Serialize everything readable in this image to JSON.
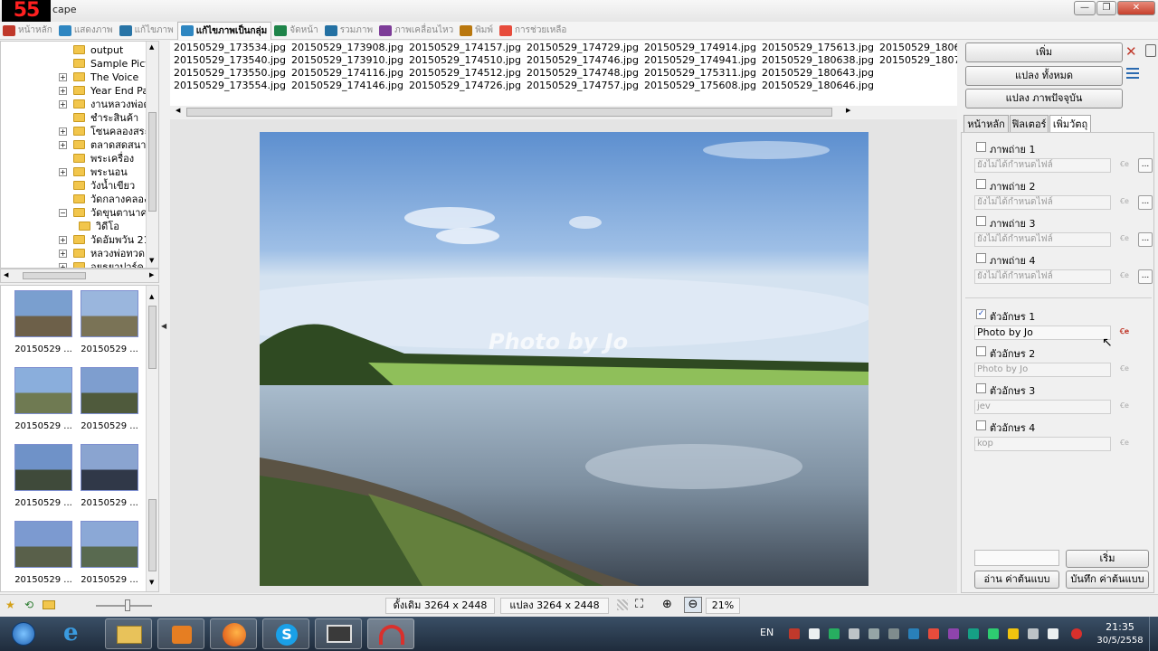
{
  "window": {
    "logo": "55",
    "title": "cape",
    "controls": [
      "—",
      "❐",
      "✕"
    ]
  },
  "menu": [
    {
      "label": "หน้าหลัก",
      "icon": "home-icon",
      "color": "#c0392b",
      "active": false
    },
    {
      "label": "แสดงภาพ",
      "icon": "view-icon",
      "color": "#2e86c1",
      "active": false
    },
    {
      "label": "แก้ไขภาพ",
      "icon": "edit-icon",
      "color": "#2874a6",
      "active": false
    },
    {
      "label": "แก้ไขภาพเป็นกลุ่ม",
      "icon": "batch-edit-icon",
      "color": "#2e86c1",
      "active": true
    },
    {
      "label": "จัดหน้า",
      "icon": "page-layout-icon",
      "color": "#1e8449",
      "active": false
    },
    {
      "label": "รวมภาพ",
      "icon": "combine-icon",
      "color": "#2471a3",
      "active": false
    },
    {
      "label": "ภาพเคลื่อนไหว",
      "icon": "animation-icon",
      "color": "#7d3c98",
      "active": false
    },
    {
      "label": "พิมพ์",
      "icon": "print-icon",
      "color": "#b9770e",
      "active": false
    },
    {
      "label": "การช่วยเหลือ",
      "icon": "help-icon",
      "color": "#e74c3c",
      "active": false
    }
  ],
  "tree": [
    {
      "label": "output",
      "exp": false
    },
    {
      "label": "Sample Pict",
      "exp": false
    },
    {
      "label": "The Voice",
      "exp": true
    },
    {
      "label": "Year End Pa",
      "exp": true
    },
    {
      "label": "งานหลวงพ่อดู",
      "exp": true
    },
    {
      "label": "ชำระสินค้า",
      "exp": false
    },
    {
      "label": "โซนคลองสระ",
      "exp": true
    },
    {
      "label": "ตลาดสดสนาม",
      "exp": true
    },
    {
      "label": "พระเครื่อง",
      "exp": false
    },
    {
      "label": "พระนอน",
      "exp": true
    },
    {
      "label": "วังน้ำเขียว",
      "exp": false
    },
    {
      "label": "วัดกลางคลอง",
      "exp": false
    },
    {
      "label": "วัดขุนตานาค",
      "exp": true
    },
    {
      "label": "วิดีโอ",
      "exp": false
    },
    {
      "label": "วัดอัมพวัน 21",
      "exp": true
    },
    {
      "label": "หลวงพ่อทวด",
      "exp": true
    },
    {
      "label": "อยุธยาปาร์ค",
      "exp": true
    }
  ],
  "thumbnails": [
    {
      "caption": "20150529 ...",
      "sky": "#7a9fcf",
      "ground": "#6d6049"
    },
    {
      "caption": "20150529 ...",
      "sky": "#9ab6dd",
      "ground": "#7a7356"
    },
    {
      "caption": "20150529 ...",
      "sky": "#8aaedc",
      "ground": "#6f7a52"
    },
    {
      "caption": "20150529 ...",
      "sky": "#7e9ecf",
      "ground": "#4f5a3c"
    },
    {
      "caption": "20150529 ...",
      "sky": "#6f92c8",
      "ground": "#3f4a3a"
    },
    {
      "caption": "20150529 ...",
      "sky": "#8aa4d0",
      "ground": "#303848"
    },
    {
      "caption": "20150529 ...",
      "sky": "#7c9ad0",
      "ground": "#59604a"
    },
    {
      "caption": "20150529 ...",
      "sky": "#8ba8d6",
      "ground": "#596a50"
    }
  ],
  "files": [
    [
      "20150529_173534.jpg",
      "20150529_173540.jpg",
      "20150529_173550.jpg",
      "20150529_173554.jpg"
    ],
    [
      "20150529_173908.jpg",
      "20150529_173910.jpg",
      "20150529_174116.jpg",
      "20150529_174146.jpg"
    ],
    [
      "20150529_174157.jpg",
      "20150529_174510.jpg",
      "20150529_174512.jpg",
      "20150529_174726.jpg"
    ],
    [
      "20150529_174729.jpg",
      "20150529_174746.jpg",
      "20150529_174748.jpg",
      "20150529_174757.jpg"
    ],
    [
      "20150529_174914.jpg",
      "20150529_174941.jpg",
      "20150529_175311.jpg",
      "20150529_175608.jpg"
    ],
    [
      "20150529_175613.jpg",
      "20150529_180638.jpg",
      "20150529_180643.jpg",
      "20150529_180646.jpg"
    ],
    [
      "20150529_1806",
      "20150529_1807"
    ]
  ],
  "preview": {
    "watermark": "Photo by Jo"
  },
  "panel": {
    "add_label": "เพิ่ม",
    "convert_all_label": "แปลง ทั้งหมด",
    "convert_current_label": "แปลง ภาพปัจจุบัน",
    "tabs": [
      {
        "label": "หน้าหลัก",
        "active": false
      },
      {
        "label": "ฟิลเตอร์",
        "active": false
      },
      {
        "label": "เพิ่มวัตถุ",
        "active": true
      }
    ],
    "images": [
      {
        "label": "ภาพถ่าย 1",
        "value": "ยังไม่ได้กำหนดไฟล์"
      },
      {
        "label": "ภาพถ่าย 2",
        "value": "ยังไม่ได้กำหนดไฟล์"
      },
      {
        "label": "ภาพถ่าย 3",
        "value": "ยังไม่ได้กำหนดไฟล์"
      },
      {
        "label": "ภาพถ่าย 4",
        "value": "ยังไม่ได้กำหนดไฟล์"
      }
    ],
    "texts": [
      {
        "label": "ตัวอักษร 1",
        "value": "Photo by Jo",
        "checked": true
      },
      {
        "label": "ตัวอักษร 2",
        "value": "Photo by Jo",
        "checked": false
      },
      {
        "label": "ตัวอักษร 3",
        "value": "jev",
        "checked": false
      },
      {
        "label": "ตัวอักษร 4",
        "value": "kop",
        "checked": false
      }
    ],
    "start_label": "เริ่ม",
    "read_template_label": "อ่าน ค่าต้นแบบ",
    "save_template_label": "บันทึก ค่าต้นแบบ"
  },
  "status": {
    "original": "ดั้งเดิม 3264 x 2448",
    "converted": "แปลง 3264 x 2448",
    "zoom": "21%"
  },
  "taskbar": {
    "lang": "EN",
    "time": "21:35",
    "date": "30/5/2558",
    "apps": [
      "windows-start-icon",
      "internet-explorer-icon",
      "file-explorer-icon",
      "media-player-icon",
      "firefox-icon",
      "skype-icon",
      "photoscape-viewer-icon",
      "photoscape-icon"
    ]
  }
}
